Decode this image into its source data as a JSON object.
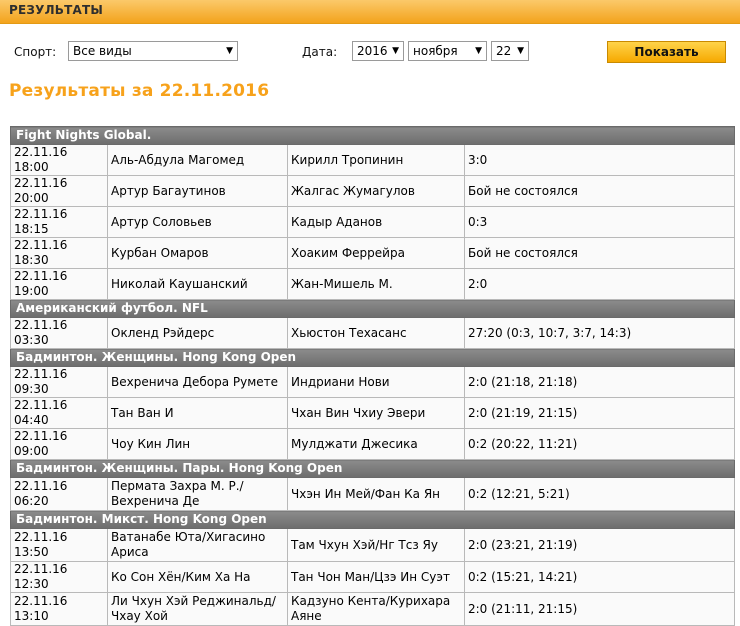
{
  "header": {
    "title": "РЕЗУЛЬТАТЫ"
  },
  "filters": {
    "sport_label": "Спорт:",
    "sport_value": "Все виды",
    "date_label": "Дата:",
    "year_value": "2016",
    "month_value": "ноября",
    "day_value": "22",
    "submit_label": "Показать"
  },
  "page_title": "Результаты за 22.11.2016",
  "groups": [
    {
      "name": "Fight Nights Global.",
      "rows": [
        {
          "time": "22.11.16 18:00",
          "home": "Аль-Абдула Магомед",
          "away": "Кирилл Тропинин",
          "result": "3:0"
        },
        {
          "time": "22.11.16 20:00",
          "home": "Артур Багаутинов",
          "away": "Жалгас Жумагулов",
          "result": " Бой не состоялся"
        },
        {
          "time": "22.11.16 18:15",
          "home": "Артур Соловьев",
          "away": "Кадыр Аданов",
          "result": "0:3"
        },
        {
          "time": "22.11.16 18:30",
          "home": "Курбан Омаров",
          "away": "Хоаким Феррейра",
          "result": " Бой не состоялся"
        },
        {
          "time": "22.11.16 19:00",
          "home": "Николай Каушанский",
          "away": "Жан-Мишель М.",
          "result": "2:0"
        }
      ]
    },
    {
      "name": "Американский футбол. NFL",
      "rows": [
        {
          "time": "22.11.16 03:30",
          "home": "Окленд Рэйдерс",
          "away": "Хьюстон Техасанс",
          "result": "27:20 (0:3, 10:7, 3:7, 14:3)"
        }
      ]
    },
    {
      "name": "Бадминтон. Женщины. Hong Kong Open",
      "rows": [
        {
          "time": "22.11.16 09:30",
          "home": "Вехреничa Дебора Румете",
          "away": "Индриани Нови",
          "result": "2:0 (21:18, 21:18)"
        },
        {
          "time": "22.11.16 04:40",
          "home": "Тан Ван И",
          "away": "Чхан Вин Чхиу Эвери",
          "result": "2:0 (21:19, 21:15)"
        },
        {
          "time": "22.11.16 09:00",
          "home": "Чоу Кин Лин",
          "away": "Мулджати Джесика",
          "result": "0:2 (20:22, 11:21)"
        }
      ]
    },
    {
      "name": "Бадминтон. Женщины. Пары. Hong Kong Open",
      "rows": [
        {
          "time": "22.11.16 06:20",
          "home": "Пермата Захра М. Р./ Вехреничa Де",
          "away": "Чхэн Ин Мей/Фан Ка Ян",
          "result": "0:2 (12:21, 5:21)",
          "tall": true
        }
      ]
    },
    {
      "name": "Бадминтон. Микст. Hong Kong Open",
      "rows": [
        {
          "time": "22.11.16 13:50",
          "home": "Ватанабе Юта/Хигасино Ариса",
          "away": "Там Чхун Хэй/Нг Тсз Яу",
          "result": "2:0 (23:21, 21:19)",
          "tall": true
        },
        {
          "time": "22.11.16 12:30",
          "home": "Ко Сон Хён/Ким Ха На",
          "away": "Тан Чон Ман/Цзэ Ин Суэт",
          "result": "0:2 (15:21, 14:21)"
        },
        {
          "time": "22.11.16 13:10",
          "home": "Ли Чхун Хэй Реджинальд/ Чхау Хой",
          "away": "Кадзуно Кента/Курихара Аяне",
          "result": "2:0 (21:11, 21:15)",
          "tall": true
        }
      ]
    }
  ]
}
